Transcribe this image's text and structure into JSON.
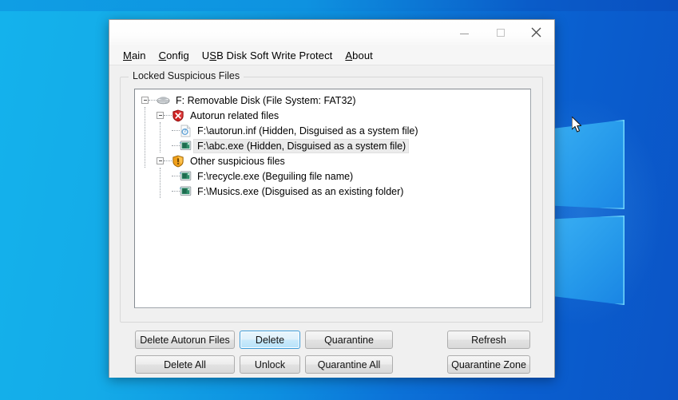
{
  "desktop": {
    "wallpaper_name": "windows-10-hero-wallpaper",
    "accent_color": "#14b2ec",
    "cursor_name": "arrow-cursor"
  },
  "window": {
    "title": "",
    "controls": {
      "minimize_label": "Minimize",
      "maximize_label": "Maximize",
      "close_label": "Close"
    }
  },
  "menubar": {
    "items": [
      {
        "label": "Main",
        "accel": "M"
      },
      {
        "label": "Config",
        "accel": "C"
      },
      {
        "label": "USB Disk Soft Write Protect",
        "accel": "S"
      },
      {
        "label": "About",
        "accel": "A"
      }
    ]
  },
  "groupbox": {
    "label": "Locked Suspicious Files"
  },
  "tree": {
    "nodes": [
      {
        "level": 0,
        "icon": "removable-disk-icon",
        "label": "F: Removable Disk (File System: FAT32)",
        "expanded": true,
        "selected": false
      },
      {
        "level": 1,
        "icon": "red-shield-icon",
        "label": "Autorun related files",
        "expanded": true,
        "selected": false
      },
      {
        "level": 2,
        "icon": "inf-file-icon",
        "label": "F:\\autorun.inf (Hidden, Disguised as a system file)",
        "expanded": false,
        "selected": false
      },
      {
        "level": 2,
        "icon": "exe-file-icon",
        "label": "F:\\abc.exe (Hidden, Disguised as a system file)",
        "expanded": false,
        "selected": true
      },
      {
        "level": 1,
        "icon": "orange-shield-icon",
        "label": "Other suspicious files",
        "expanded": true,
        "selected": false
      },
      {
        "level": 2,
        "icon": "exe-file-icon",
        "label": "F:\\recycle.exe (Beguiling file name)",
        "expanded": false,
        "selected": false
      },
      {
        "level": 2,
        "icon": "exe-file-icon",
        "label": "F:\\Musics.exe (Disguised as an existing folder)",
        "expanded": false,
        "selected": false
      }
    ]
  },
  "buttons": {
    "delete_autorun_files": "Delete Autorun Files",
    "delete": "Delete",
    "quarantine": "Quarantine",
    "refresh": "Refresh",
    "delete_all": "Delete All",
    "unlock": "Unlock",
    "quarantine_all": "Quarantine All",
    "quarantine_zone": "Quarantine Zone",
    "focused": "Delete"
  }
}
